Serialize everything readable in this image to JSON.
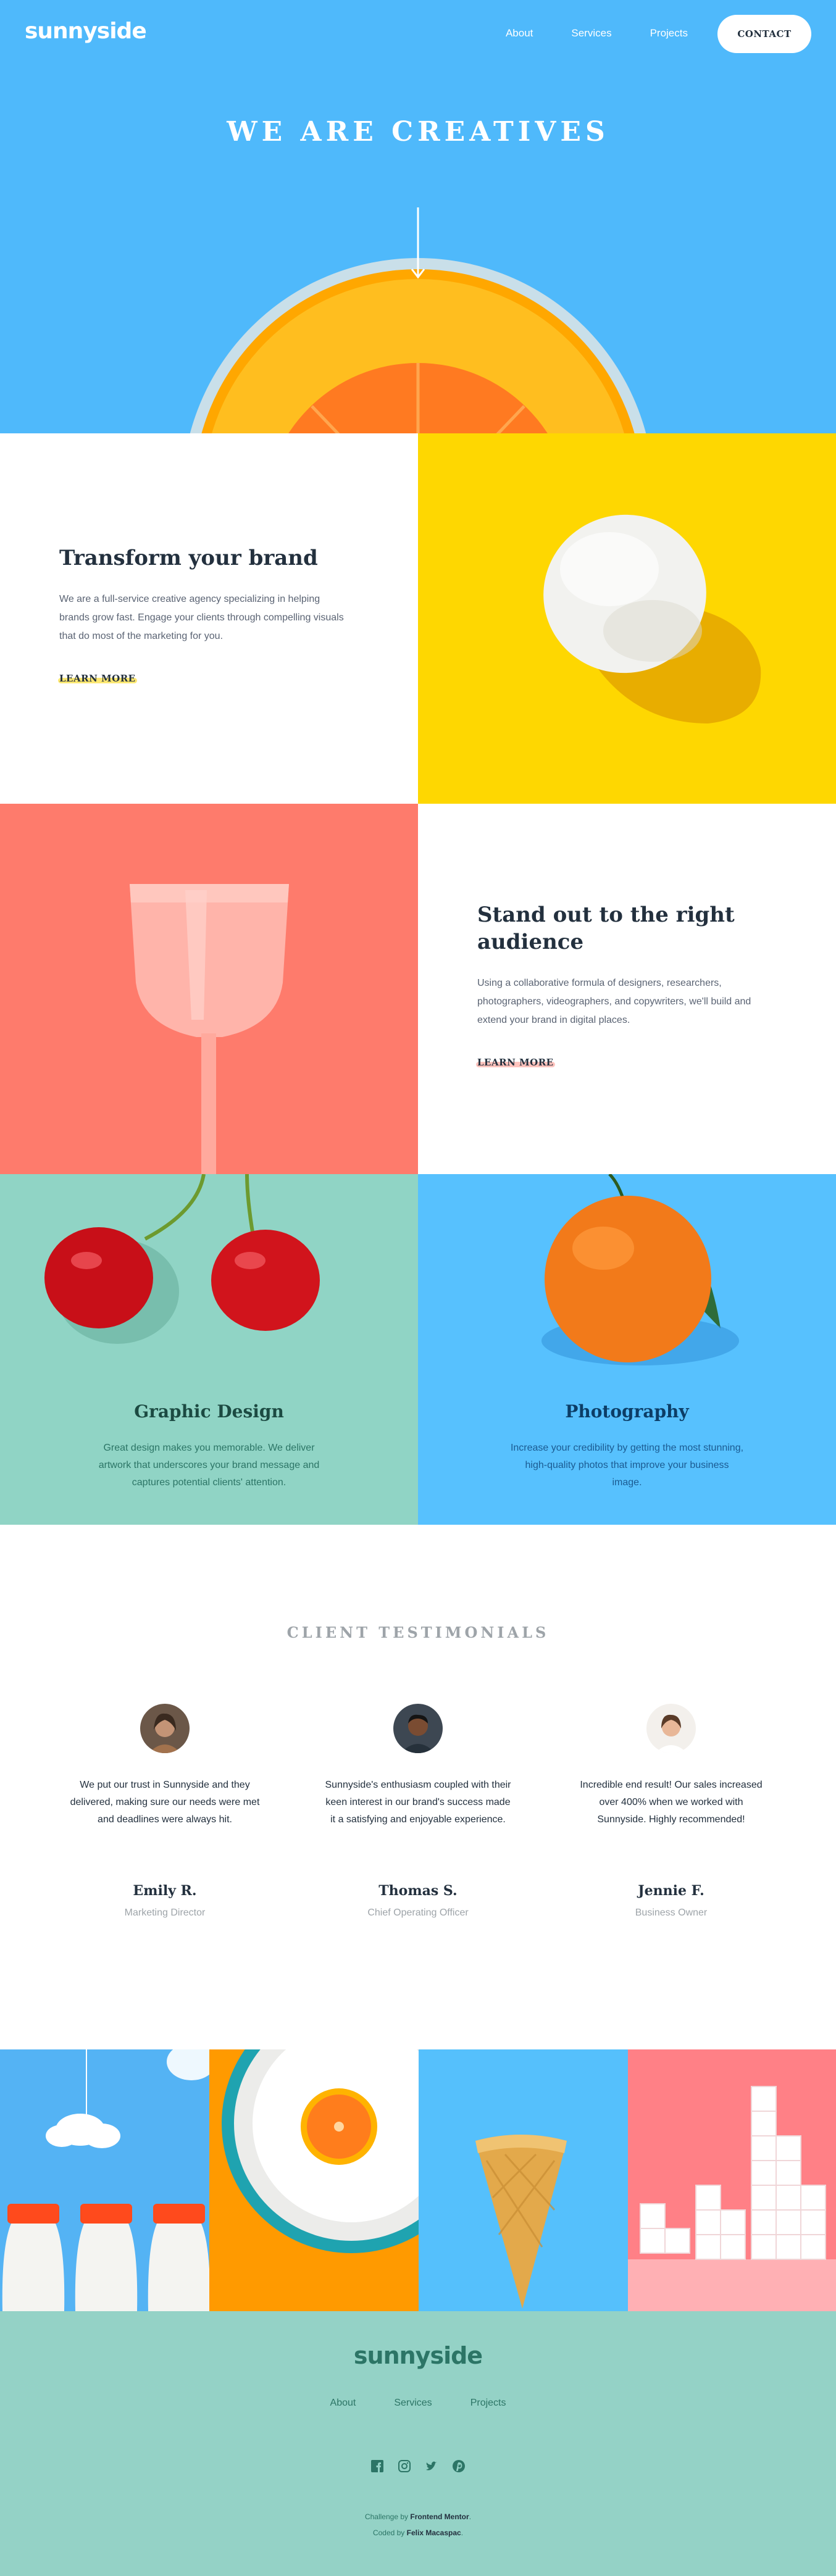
{
  "brand": {
    "logo": "sunnyside"
  },
  "nav": {
    "items": [
      "About",
      "Services",
      "Projects"
    ],
    "contact": "CONTACT"
  },
  "hero": {
    "title": "WE ARE CREATIVES"
  },
  "features": [
    {
      "title": "Transform your brand",
      "text": "We are a full-service creative agency specializing in helping brands grow fast. Engage your clients through compelling visuals that do most of the marketing for you.",
      "link": "LEARN MORE"
    },
    {
      "title": "Stand out to the right audience",
      "text": "Using a collaborative formula of designers, researchers, photographers, videographers, and copywriters, we'll build and extend your brand in digital places.",
      "link": "LEARN MORE"
    }
  ],
  "services": [
    {
      "title": "Graphic Design",
      "text": "Great design makes you memorable. We deliver artwork that underscores your brand message and captures potential clients' attention."
    },
    {
      "title": "Photography",
      "text": "Increase your credibility by getting the most stunning, high-quality photos that improve your business image."
    }
  ],
  "testimonials": {
    "heading": "CLIENT TESTIMONIALS",
    "items": [
      {
        "quote": "We put our trust in Sunnyside and they delivered, making sure our needs were met and deadlines were always hit.",
        "name": "Emily R.",
        "role": "Marketing Director"
      },
      {
        "quote": "Sunnyside's enthusiasm coupled with their keen interest in our brand's success made it a satisfying and enjoyable experience.",
        "name": "Thomas S.",
        "role": "Chief Operating Officer"
      },
      {
        "quote": "Incredible end result! Our sales increased over 400% when we worked with Sunnyside. Highly recommended!",
        "name": "Jennie F.",
        "role": "Business Owner"
      }
    ]
  },
  "footer": {
    "logo": "sunnyside",
    "links": [
      "About",
      "Services",
      "Projects"
    ],
    "social_icons": [
      "facebook-icon",
      "instagram-icon",
      "twitter-icon",
      "pinterest-icon"
    ],
    "challenge_prefix": "Challenge by",
    "challenge_link": "Frontend Mentor",
    "coded_prefix": "Coded by",
    "coded_name": "Felix Macaspac"
  },
  "colors": {
    "hero_blue": "#4fb9fb",
    "yellow": "#fed701",
    "coral": "#fe7a6c",
    "mint": "#90d4c5",
    "photo_blue": "#57c1fe",
    "footer": "#94d2c6",
    "dark_text": "#23303e"
  }
}
